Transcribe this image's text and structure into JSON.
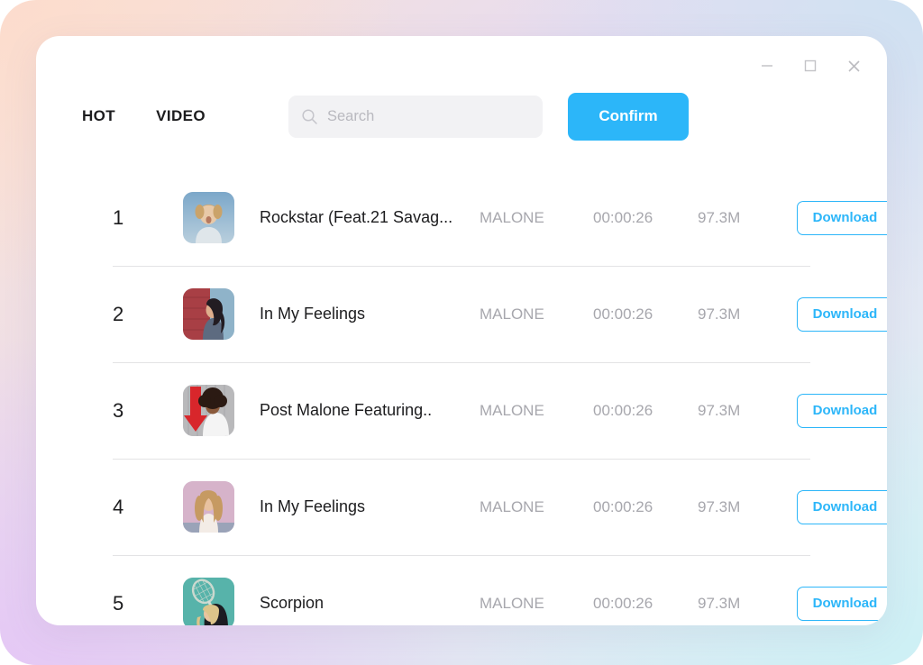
{
  "window": {
    "controls": [
      {
        "name": "minimize",
        "label": "—"
      },
      {
        "name": "maximize",
        "label": "□"
      },
      {
        "name": "close",
        "label": "✕"
      }
    ]
  },
  "toolbar": {
    "tabs": [
      {
        "id": "hot",
        "label": "HOT",
        "active": true
      },
      {
        "id": "video",
        "label": "VIDEO",
        "active": false
      }
    ],
    "search": {
      "value": "",
      "placeholder": "Search",
      "icon": "search-icon"
    },
    "confirm_label": "Confirm"
  },
  "colors": {
    "accent": "#2cb6f9",
    "text_primary": "#1c1c1e",
    "text_muted": "#a7a7ad",
    "divider": "#e3e3e5",
    "search_bg": "#f2f2f4"
  },
  "list": {
    "download_label": "Download",
    "rows": [
      {
        "rank": "1",
        "title": "Rockstar (Feat.21 Savag...",
        "artist": "MALONE",
        "duration": "00:00:26",
        "size": "97.3M",
        "thumb": "portrait-blue-background"
      },
      {
        "rank": "2",
        "title": "In My Feelings",
        "artist": "MALONE",
        "duration": "00:00:26",
        "size": "97.3M",
        "thumb": "portrait-red-blue-wall"
      },
      {
        "rank": "3",
        "title": "Post Malone Featuring..",
        "artist": "MALONE",
        "duration": "00:00:26",
        "size": "97.3M",
        "thumb": "portrait-red-arrow"
      },
      {
        "rank": "4",
        "title": "In My Feelings",
        "artist": "MALONE",
        "duration": "00:00:26",
        "size": "97.3M",
        "thumb": "portrait-pink-background"
      },
      {
        "rank": "5",
        "title": "Scorpion",
        "artist": "MALONE",
        "duration": "00:00:26",
        "size": "97.3M",
        "thumb": "portrait-teal-tennis"
      }
    ]
  }
}
